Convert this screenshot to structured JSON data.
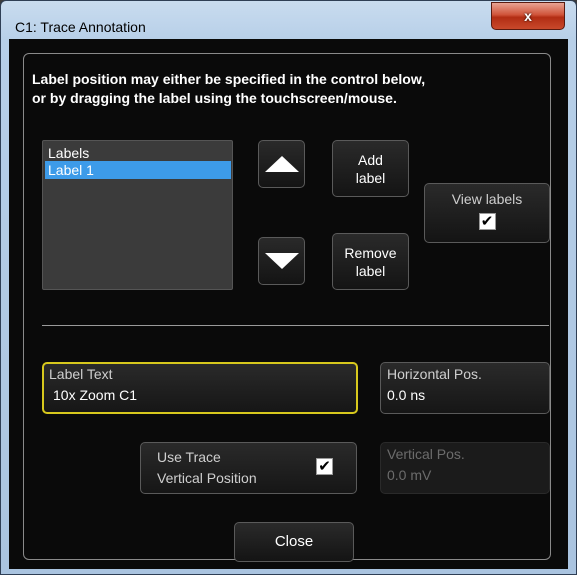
{
  "window": {
    "title": "C1: Trace Annotation",
    "close_glyph": "x"
  },
  "instructions": {
    "line1": "Label position may either be specified in the control below,",
    "line2": "or by dragging the label using the touchscreen/mouse."
  },
  "labels": {
    "header": "Labels",
    "items": [
      "Label 1"
    ],
    "selected_index": 0
  },
  "buttons": {
    "add_label_line1": "Add",
    "add_label_line2": "label",
    "remove_label_line1": "Remove",
    "remove_label_line2": "label",
    "close": "Close",
    "up_icon": "arrow-up-icon",
    "down_icon": "arrow-down-icon"
  },
  "view_labels": {
    "label": "View labels",
    "checked": true,
    "check_glyph": "✔"
  },
  "label_text": {
    "label": "Label Text",
    "value": "10x Zoom C1"
  },
  "horizontal_pos": {
    "label": "Horizontal Pos.",
    "value": "0.0 ns"
  },
  "use_trace": {
    "line1": "Use Trace",
    "line2": "Vertical Position",
    "checked": true,
    "check_glyph": "✔"
  },
  "vertical_pos": {
    "label": "Vertical Pos.",
    "value": "0.0 mV",
    "enabled": false
  },
  "colors": {
    "selection": "#3d9be9",
    "active_border": "#d7c81d",
    "close_button": "#c9492b"
  }
}
